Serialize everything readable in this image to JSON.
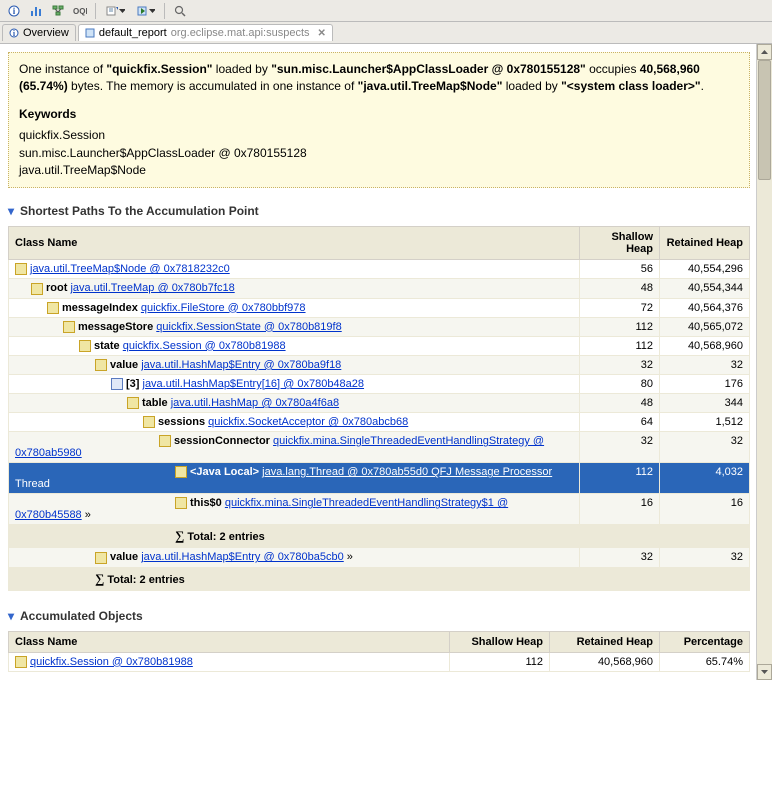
{
  "toolbar": {
    "icons": [
      "info-icon",
      "histogram-icon",
      "tree-icon",
      "oql-icon",
      "run-icon",
      "export-icon",
      "search-icon"
    ]
  },
  "tabs": {
    "overview": "Overview",
    "report_label": "default_report",
    "report_detail": "org.eclipse.mat.api:suspects"
  },
  "description": {
    "line1_a": "One instance of ",
    "line1_b": "\"quickfix.Session\"",
    "line1_c": " loaded by ",
    "line1_d": "\"sun.misc.Launcher$AppClassLoader @ 0x780155128\"",
    "line1_e": " occupies ",
    "line1_f": "40,568,960 (65.74%)",
    "line1_g": " bytes. The memory is accumulated in one instance of ",
    "line1_h": "\"java.util.TreeMap$Node\"",
    "line1_i": " loaded by ",
    "line1_j": "\"<system class loader>\"",
    "line1_k": ".",
    "kw_header": "Keywords",
    "kw1": "quickfix.Session",
    "kw2": "sun.misc.Launcher$AppClassLoader @ 0x780155128",
    "kw3": "java.util.TreeMap$Node"
  },
  "section1": "Shortest Paths To the Accumulation Point",
  "section2": "Accumulated Objects",
  "path_table": {
    "col_class": "Class Name",
    "col_shallow": "Shallow Heap",
    "col_retained": "Retained Heap",
    "rows": [
      {
        "indent": 0,
        "prefix": "",
        "link": "java.util.TreeMap$Node @ 0x7818232c0",
        "suffix": "",
        "shallow": "56",
        "retained": "40,554,296"
      },
      {
        "indent": 1,
        "prefix": "root ",
        "link": "java.util.TreeMap @ 0x780b7fc18",
        "suffix": "",
        "shallow": "48",
        "retained": "40,554,344"
      },
      {
        "indent": 2,
        "prefix": "messageIndex ",
        "link": "quickfix.FileStore @ 0x780bbf978",
        "suffix": "",
        "shallow": "72",
        "retained": "40,564,376"
      },
      {
        "indent": 3,
        "prefix": "messageStore ",
        "link": "quickfix.SessionState @ 0x780b819f8",
        "suffix": "",
        "shallow": "112",
        "retained": "40,565,072"
      },
      {
        "indent": 4,
        "prefix": "state ",
        "link": "quickfix.Session @ 0x780b81988",
        "suffix": "",
        "shallow": "112",
        "retained": "40,568,960"
      },
      {
        "indent": 5,
        "prefix": "value ",
        "link": "java.util.HashMap$Entry @ 0x780ba9f18",
        "suffix": "",
        "shallow": "32",
        "retained": "32"
      },
      {
        "indent": 6,
        "prefix": "[3] ",
        "link": "java.util.HashMap$Entry[16] @ 0x780b48a28",
        "suffix": "",
        "special": true,
        "shallow": "80",
        "retained": "176"
      },
      {
        "indent": 7,
        "prefix": "table ",
        "link": "java.util.HashMap @ 0x780a4f6a8",
        "suffix": "",
        "shallow": "48",
        "retained": "344"
      },
      {
        "indent": 8,
        "prefix": "sessions ",
        "link": "quickfix.SocketAcceptor @ 0x780abcb68",
        "suffix": "",
        "shallow": "64",
        "retained": "1,512"
      },
      {
        "indent": 9,
        "prefix": "sessionConnector ",
        "link": "quickfix.mina.SingleThreadedEventHandlingStrategy @ 0x780ab5980",
        "suffix": "",
        "wrap": true,
        "shallow": "32",
        "retained": "32"
      },
      {
        "indent": 10,
        "prefix": "<Java Local> ",
        "link": "java.lang.Thread @ 0x780ab55d0 QFJ Message Processor",
        "suffix": " Thread",
        "wrap": true,
        "selected": true,
        "shallow": "112",
        "retained": "4,032"
      },
      {
        "indent": 10,
        "prefix": "this$0 ",
        "link": "quickfix.mina.SingleThreadedEventHandlingStrategy$1 @ 0x780b45588",
        "suffix": " »",
        "wrap": true,
        "shallow": "16",
        "retained": "16"
      },
      {
        "indent": 10,
        "total": true,
        "text": "Total: 2 entries",
        "shallow": "",
        "retained": ""
      },
      {
        "indent": 5,
        "prefix": "value ",
        "link": "java.util.HashMap$Entry @ 0x780ba5cb0",
        "suffix": " »",
        "shallow": "32",
        "retained": "32"
      },
      {
        "indent": 5,
        "total": true,
        "text": "Total: 2 entries",
        "shallow": "",
        "retained": ""
      }
    ]
  },
  "acc_table": {
    "col_class": "Class Name",
    "col_shallow": "Shallow Heap",
    "col_retained": "Retained Heap",
    "col_pct": "Percentage",
    "rows": [
      {
        "indent": 0,
        "link": "quickfix.Session @ 0x780b81988",
        "shallow": "112",
        "retained": "40,568,960",
        "pct": "65.74%"
      }
    ]
  }
}
